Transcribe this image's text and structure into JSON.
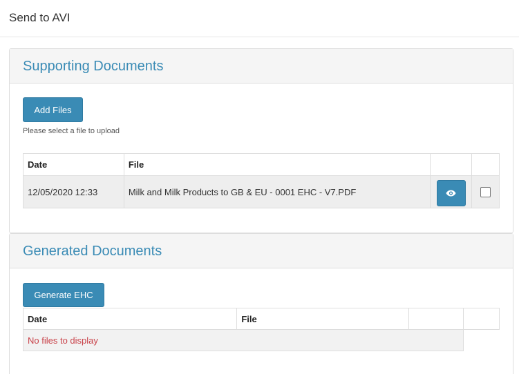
{
  "header": {
    "title": "Send to AVI"
  },
  "supporting": {
    "heading": "Supporting Documents",
    "add_button": "Add Files",
    "hint": "Please select a file to upload",
    "columns": [
      "Date",
      "File"
    ],
    "rows": [
      {
        "date": "12/05/2020 12:33",
        "file": "Milk and Milk Products to GB & EU - 0001 EHC - V7.PDF",
        "action_icon": "eye-icon",
        "selected": false
      }
    ]
  },
  "generated": {
    "heading": "Generated Documents",
    "generate_button": "Generate EHC",
    "columns": [
      "Date",
      "File"
    ],
    "empty_text": "No files to display"
  },
  "colors": {
    "accent": "#3a8bb5",
    "error": "#c9434a",
    "panel_heading_bg": "#f5f5f5"
  }
}
